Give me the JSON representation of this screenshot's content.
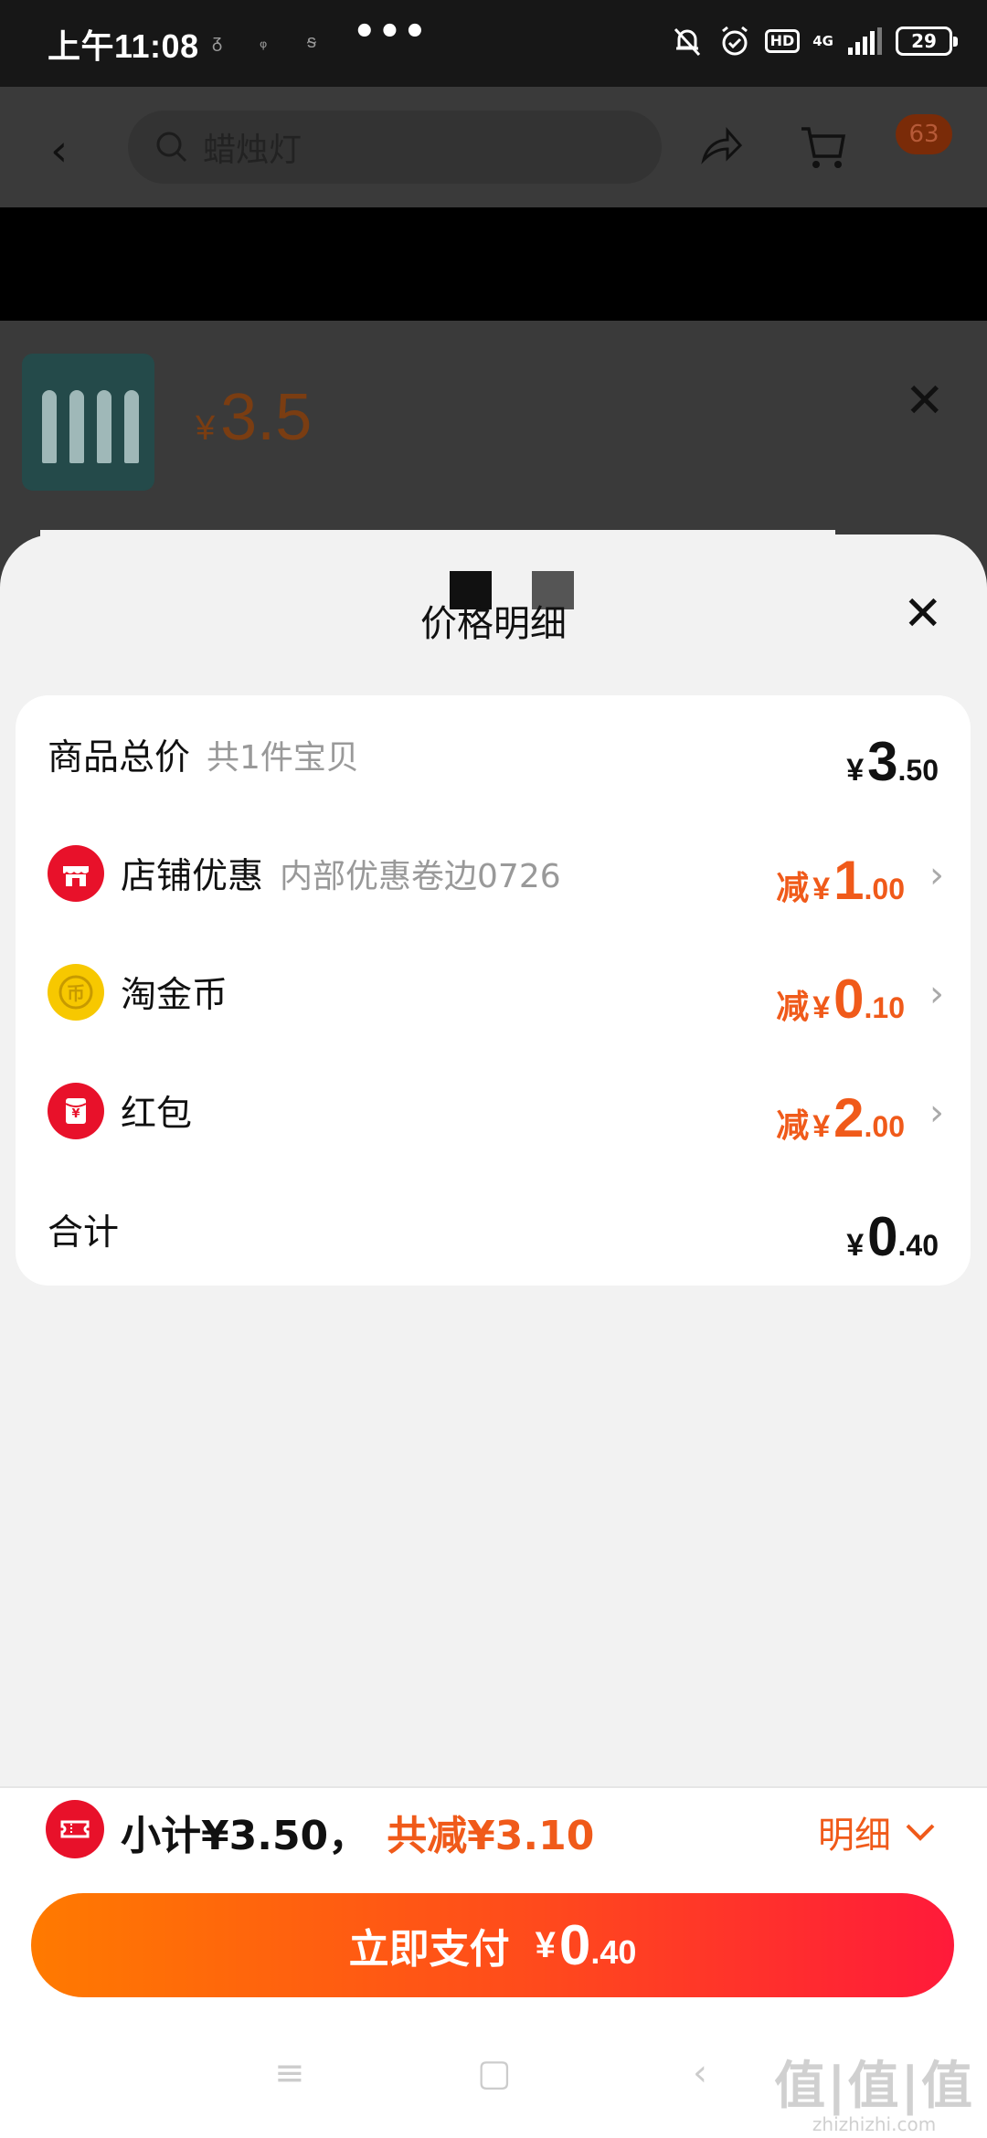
{
  "status_bar": {
    "time": "上午11:08",
    "dots": "•••",
    "hd": "HD",
    "network": "4G",
    "battery": "29"
  },
  "top_nav": {
    "search_text": "蜡烛灯",
    "cart_badge": "63"
  },
  "product": {
    "currency": "¥",
    "price": "3.5"
  },
  "sheet": {
    "title": "价格明细",
    "rows": [
      {
        "label": "商品总价",
        "sub": "共1件宝贝",
        "prefix": "",
        "currency": "¥",
        "int": "3",
        "dec": ".50"
      },
      {
        "label": "店铺优惠",
        "sub": "内部优惠卷边0726",
        "prefix": "减",
        "currency": "¥",
        "int": "1",
        "dec": ".00",
        "icon": "shop-icon"
      },
      {
        "label": "淘金币",
        "sub": "",
        "prefix": "减",
        "currency": "¥",
        "int": "0",
        "dec": ".10",
        "icon": "gold-coin-icon"
      },
      {
        "label": "红包",
        "sub": "",
        "prefix": "减",
        "currency": "¥",
        "int": "2",
        "dec": ".00",
        "icon": "red-packet-icon"
      },
      {
        "label": "合计",
        "sub": "",
        "prefix": "",
        "currency": "¥",
        "int": "0",
        "dec": ".40"
      }
    ]
  },
  "summary": {
    "subtotal": "小计¥3.50，",
    "discount": "共减¥3.10",
    "detail_label": "明细"
  },
  "pay_button": {
    "label": "立即支付",
    "currency": "¥",
    "int": "0",
    "dec": ".40"
  },
  "watermark": {
    "main": "值|值|值",
    "site": "zhizhizhi.com"
  },
  "colors": {
    "accent": "#f05a1a",
    "pay_gradient_start": "#ff7a00",
    "pay_gradient_end": "#ff1a3a",
    "icon_red": "#e8112a",
    "coin_yellow": "#f7c800"
  }
}
